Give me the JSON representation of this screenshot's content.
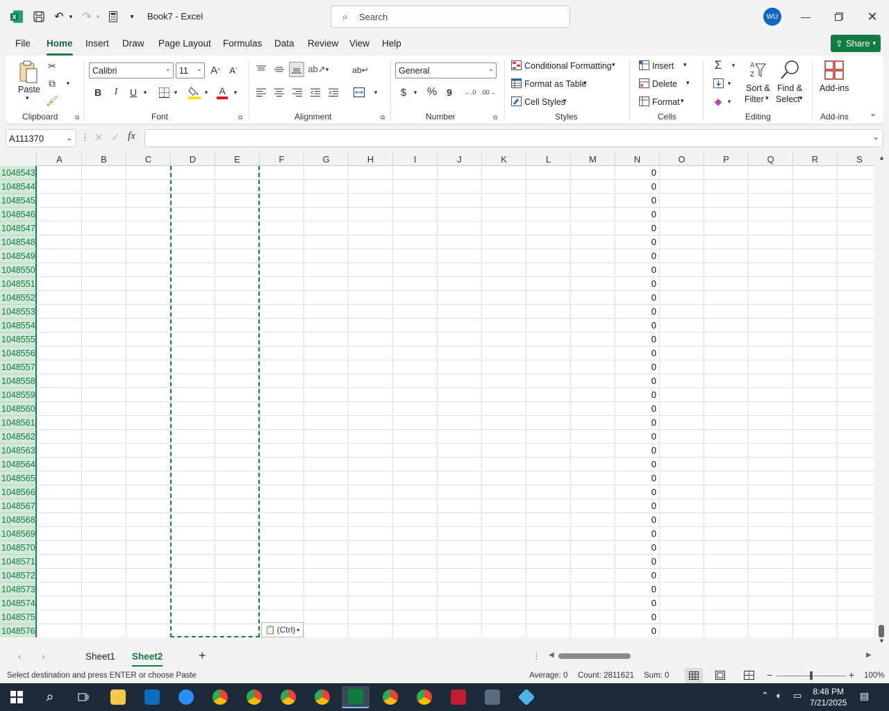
{
  "window": {
    "title": "Book7  -  Excel",
    "search_placeholder": "Search",
    "user_initials": "WU",
    "share_label": "Share"
  },
  "menu": {
    "tabs": [
      "File",
      "Home",
      "Insert",
      "Draw",
      "Page Layout",
      "Formulas",
      "Data",
      "Review",
      "View",
      "Help"
    ],
    "active": "Home"
  },
  "ribbon": {
    "clipboard": {
      "paste": "Paste",
      "label": "Clipboard"
    },
    "font": {
      "name": "Calibri",
      "size": "11",
      "label": "Font",
      "bold": "B",
      "italic": "I",
      "underline": "U"
    },
    "alignment": {
      "label": "Alignment"
    },
    "number": {
      "format": "General",
      "label": "Number",
      "currency": "$",
      "percent": "%",
      "comma": "9"
    },
    "styles": {
      "conditional": "Conditional Formatting",
      "table": "Format as Table",
      "cell": "Cell Styles",
      "label": "Styles"
    },
    "cells": {
      "insert": "Insert",
      "delete": "Delete",
      "format": "Format",
      "label": "Cells"
    },
    "editing": {
      "sort_l1": "Sort &",
      "sort_l2": "Filter",
      "find_l1": "Find &",
      "find_l2": "Select",
      "label": "Editing"
    },
    "addins": {
      "btn": "Add-ins",
      "label": "Add-ins"
    }
  },
  "formula_bar": {
    "name_box": "A111370",
    "fx": "fx",
    "value": ""
  },
  "columns": [
    "A",
    "B",
    "C",
    "D",
    "E",
    "F",
    "G",
    "H",
    "I",
    "J",
    "K",
    "L",
    "M",
    "N",
    "O",
    "P",
    "Q",
    "R",
    "S"
  ],
  "rows": [
    {
      "num": "1048543",
      "N": "0"
    },
    {
      "num": "1048544",
      "N": "0"
    },
    {
      "num": "1048545",
      "N": "0"
    },
    {
      "num": "1048546",
      "N": "0"
    },
    {
      "num": "1048547",
      "N": "0"
    },
    {
      "num": "1048548",
      "N": "0"
    },
    {
      "num": "1048549",
      "N": "0"
    },
    {
      "num": "1048550",
      "N": "0"
    },
    {
      "num": "1048551",
      "N": "0"
    },
    {
      "num": "1048552",
      "N": "0"
    },
    {
      "num": "1048553",
      "N": "0"
    },
    {
      "num": "1048554",
      "N": "0"
    },
    {
      "num": "1048555",
      "N": "0"
    },
    {
      "num": "1048556",
      "N": "0"
    },
    {
      "num": "1048557",
      "N": "0"
    },
    {
      "num": "1048558",
      "N": "0"
    },
    {
      "num": "1048559",
      "N": "0"
    },
    {
      "num": "1048560",
      "N": "0"
    },
    {
      "num": "1048561",
      "N": "0"
    },
    {
      "num": "1048562",
      "N": "0"
    },
    {
      "num": "1048563",
      "N": "0"
    },
    {
      "num": "1048564",
      "N": "0"
    },
    {
      "num": "1048565",
      "N": "0"
    },
    {
      "num": "1048566",
      "N": "0"
    },
    {
      "num": "1048567",
      "N": "0"
    },
    {
      "num": "1048568",
      "N": "0"
    },
    {
      "num": "1048569",
      "N": "0"
    },
    {
      "num": "1048570",
      "N": "0"
    },
    {
      "num": "1048571",
      "N": "0"
    },
    {
      "num": "1048572",
      "N": "0"
    },
    {
      "num": "1048573",
      "N": "0"
    },
    {
      "num": "1048574",
      "N": "0"
    },
    {
      "num": "1048575",
      "N": "0"
    },
    {
      "num": "1048576",
      "N": "0"
    }
  ],
  "paste_options": "(Ctrl)",
  "sheets": {
    "tabs": [
      "Sheet1",
      "Sheet2"
    ],
    "active": "Sheet2"
  },
  "status": {
    "message": "Select destination and press ENTER or choose Paste",
    "average": "Average: 0",
    "count": "Count: 2811621",
    "sum": "Sum: 0",
    "zoom": "100%"
  },
  "taskbar": {
    "time": "8:48 PM",
    "date": "7/21/2025"
  },
  "colors": {
    "accent": "#107c41",
    "taskbar": "#1c2a3a",
    "avatar": "#1066c4"
  }
}
